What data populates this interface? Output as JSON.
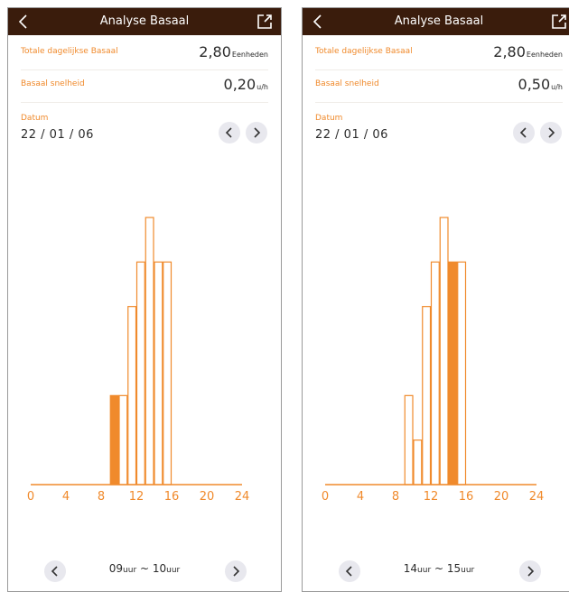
{
  "screens": [
    {
      "header": {
        "title": "Analyse Basaal"
      },
      "total": {
        "label": "Totale dagelijkse Basaal",
        "value": "2,80",
        "unit": "Eenheden"
      },
      "rate": {
        "label": "Basaal snelheid",
        "value": "0,20",
        "unit": "u/h"
      },
      "date": {
        "label": "Datum",
        "value": "22 / 01 / 06"
      },
      "range": {
        "start": "09",
        "end": "10",
        "unit": "uur",
        "sep": "~"
      }
    },
    {
      "header": {
        "title": "Analyse Basaal"
      },
      "total": {
        "label": "Totale dagelijkse Basaal",
        "value": "2,80",
        "unit": "Eenheden"
      },
      "rate": {
        "label": "Basaal snelheid",
        "value": "0,50",
        "unit": "u/h"
      },
      "date": {
        "label": "Datum",
        "value": "22 / 01 / 06"
      },
      "range": {
        "start": "14",
        "end": "15",
        "unit": "uur",
        "sep": "~"
      }
    }
  ],
  "chart_data": [
    {
      "type": "bar",
      "x": [
        0,
        1,
        2,
        3,
        4,
        5,
        6,
        7,
        8,
        9,
        10,
        11,
        12,
        13,
        14,
        15,
        16,
        17,
        18,
        19,
        20,
        21,
        22,
        23
      ],
      "xticks": [
        0,
        4,
        8,
        12,
        16,
        20,
        24
      ],
      "xlim": [
        0,
        24
      ],
      "values": [
        0,
        0,
        0,
        0,
        0,
        0,
        0,
        0,
        0,
        0.2,
        0.2,
        0.4,
        0.5,
        0.6,
        0.5,
        0.5,
        0,
        0,
        0,
        0,
        0,
        0,
        0,
        0
      ],
      "highlight_hour": 9,
      "ylim": [
        0,
        0.6
      ]
    },
    {
      "type": "bar",
      "x": [
        0,
        1,
        2,
        3,
        4,
        5,
        6,
        7,
        8,
        9,
        10,
        11,
        12,
        13,
        14,
        15,
        16,
        17,
        18,
        19,
        20,
        21,
        22,
        23
      ],
      "xticks": [
        0,
        4,
        8,
        12,
        16,
        20,
        24
      ],
      "xlim": [
        0,
        24
      ],
      "values": [
        0,
        0,
        0,
        0,
        0,
        0,
        0,
        0,
        0,
        0.2,
        0.1,
        0.4,
        0.5,
        0.6,
        0.5,
        0.5,
        0,
        0,
        0,
        0,
        0,
        0,
        0,
        0
      ],
      "highlight_hour": 14,
      "ylim": [
        0,
        0.6
      ]
    }
  ],
  "icons": {
    "back": "chevron-left-icon",
    "share": "share-icon",
    "prev": "chevron-left-icon",
    "next": "chevron-right-icon"
  },
  "colors": {
    "header": "#3a1c0c",
    "accent": "#f08a2c",
    "button": "#e8e8ee"
  }
}
